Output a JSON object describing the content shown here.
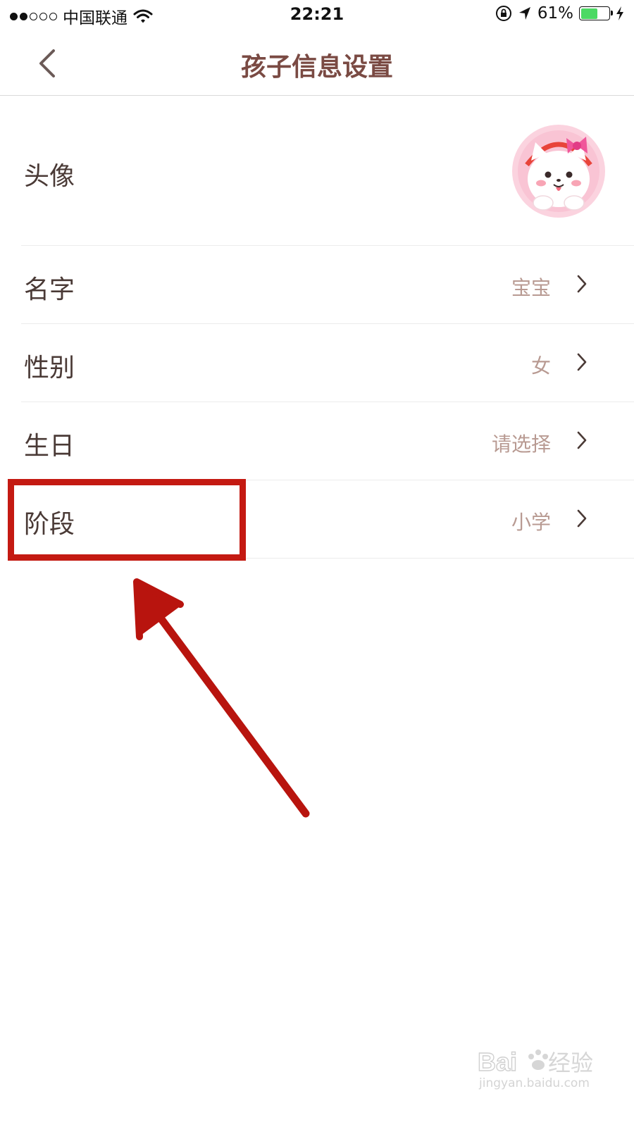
{
  "status_bar": {
    "carrier": "中国联通",
    "time": "22:21",
    "battery_percent": "61%",
    "battery_level": 0.61,
    "battery_color": "#4cd964"
  },
  "nav": {
    "title": "孩子信息设置",
    "back_icon": "chevron-left-icon"
  },
  "rows": {
    "avatar": {
      "label": "头像"
    },
    "name": {
      "label": "名字",
      "value": "宝宝"
    },
    "gender": {
      "label": "性别",
      "value": "女"
    },
    "birthday": {
      "label": "生日",
      "value": "请选择"
    },
    "stage": {
      "label": "阶段",
      "value": "小学"
    }
  },
  "watermark": {
    "logo": "Baidu经验",
    "url": "jingyan.baidu.com"
  },
  "colors": {
    "title": "#7a4a43",
    "label": "#4a3a36",
    "value": "#b89a92",
    "annotation": "#c41a12"
  }
}
